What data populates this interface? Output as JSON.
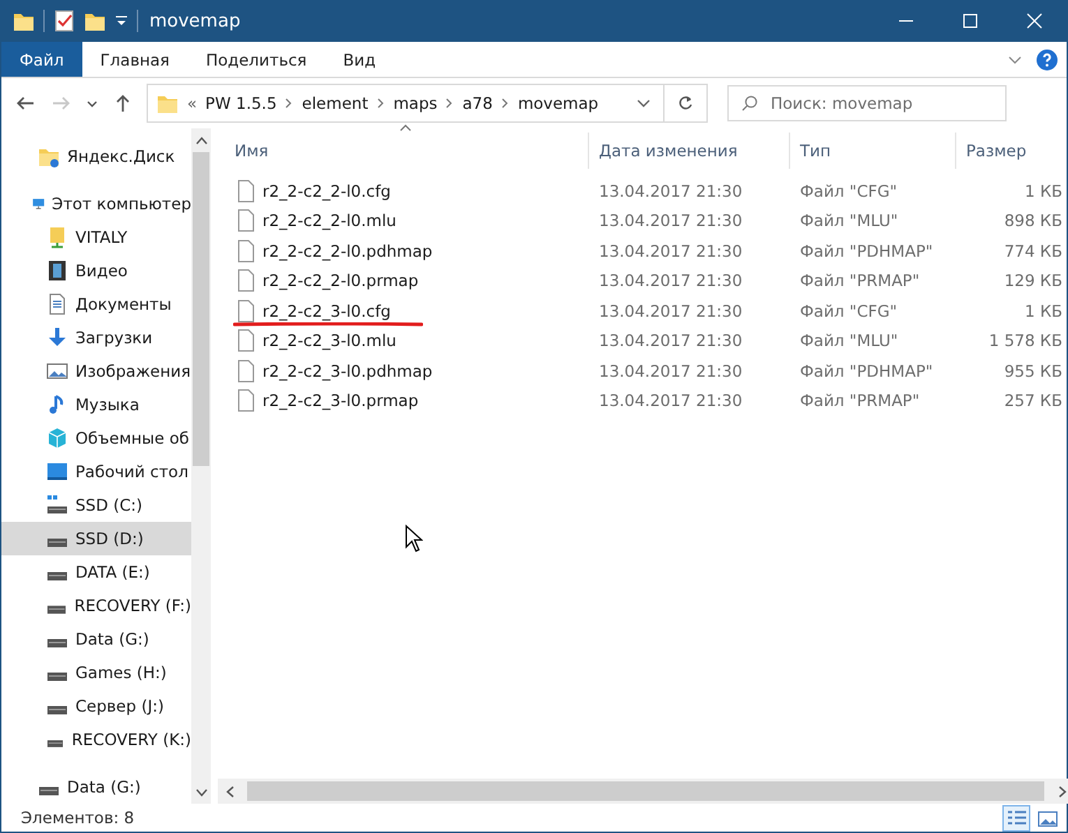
{
  "window": {
    "title": "movemap"
  },
  "ribbon_tabs": [
    {
      "label": "Файл",
      "selected": true
    },
    {
      "label": "Главная",
      "selected": false
    },
    {
      "label": "Поделиться",
      "selected": false
    },
    {
      "label": "Вид",
      "selected": false
    }
  ],
  "nav_buttons": [
    {
      "kind": "back",
      "disabled": false
    },
    {
      "kind": "forward",
      "disabled": true
    },
    {
      "kind": "recent",
      "disabled": false
    },
    {
      "kind": "up",
      "disabled": false
    }
  ],
  "address": {
    "overflow": "«",
    "crumbs": [
      "PW 1.5.5",
      "element",
      "maps",
      "a78",
      "movemap"
    ]
  },
  "search": {
    "placeholder": "Поиск: movemap"
  },
  "sidebar": {
    "items": [
      {
        "label": "Яндекс.Диск",
        "kind": "cloud",
        "selected": false
      },
      {
        "label": "Этот компьютер",
        "kind": "pc",
        "selected": false,
        "children": [
          {
            "label": "VITALY",
            "kind": "user",
            "selected": false
          },
          {
            "label": "Видео",
            "kind": "video",
            "selected": false
          },
          {
            "label": "Документы",
            "kind": "docs",
            "selected": false
          },
          {
            "label": "Загрузки",
            "kind": "downloads",
            "selected": false
          },
          {
            "label": "Изображения",
            "kind": "pictures",
            "selected": false
          },
          {
            "label": "Музыка",
            "kind": "music",
            "selected": false
          },
          {
            "label": "Объемные об",
            "kind": "objects",
            "selected": false
          },
          {
            "label": "Рабочий стол",
            "kind": "desktop",
            "selected": false
          },
          {
            "label": "SSD (C:)",
            "kind": "sysdrive",
            "selected": false
          },
          {
            "label": "SSD (D:)",
            "kind": "drive",
            "selected": true
          },
          {
            "label": "DATA (E:)",
            "kind": "drive",
            "selected": false
          },
          {
            "label": "RECOVERY (F:)",
            "kind": "drive",
            "selected": false
          },
          {
            "label": "Data (G:)",
            "kind": "drive",
            "selected": false
          },
          {
            "label": "Games (H:)",
            "kind": "drive",
            "selected": false
          },
          {
            "label": "Сервер (J:)",
            "kind": "drive",
            "selected": false
          },
          {
            "label": "RECOVERY (K:)",
            "kind": "drive",
            "selected": false
          }
        ]
      },
      {
        "label": "Data (G:)",
        "kind": "drive",
        "selected": false
      }
    ]
  },
  "table": {
    "columns": [
      {
        "label": "Имя",
        "sorted": true
      },
      {
        "label": "Дата изменения"
      },
      {
        "label": "Тип"
      },
      {
        "label": "Размер"
      }
    ],
    "rows": [
      {
        "name": "r2_2-c2_2-l0.cfg",
        "modified": "13.04.2017 21:30",
        "type": "Файл \"CFG\"",
        "size": "1 КБ"
      },
      {
        "name": "r2_2-c2_2-l0.mlu",
        "modified": "13.04.2017 21:30",
        "type": "Файл \"MLU\"",
        "size": "898 КБ"
      },
      {
        "name": "r2_2-c2_2-l0.pdhmap",
        "modified": "13.04.2017 21:30",
        "type": "Файл \"PDHMAP\"",
        "size": "774 КБ"
      },
      {
        "name": "r2_2-c2_2-l0.prmap",
        "modified": "13.04.2017 21:30",
        "type": "Файл \"PRMAP\"",
        "size": "129 КБ"
      },
      {
        "name": "r2_2-c2_3-l0.cfg",
        "modified": "13.04.2017 21:30",
        "type": "Файл \"CFG\"",
        "size": "1 КБ",
        "marked": true
      },
      {
        "name": "r2_2-c2_3-l0.mlu",
        "modified": "13.04.2017 21:30",
        "type": "Файл \"MLU\"",
        "size": "1 578 КБ"
      },
      {
        "name": "r2_2-c2_3-l0.pdhmap",
        "modified": "13.04.2017 21:30",
        "type": "Файл \"PDHMAP\"",
        "size": "955 КБ"
      },
      {
        "name": "r2_2-c2_3-l0.prmap",
        "modified": "13.04.2017 21:30",
        "type": "Файл \"PRMAP\"",
        "size": "257 КБ"
      }
    ]
  },
  "status_bar": {
    "count": "Элементов: 8",
    "views": [
      {
        "kind": "details",
        "selected": true
      },
      {
        "kind": "tiles",
        "selected": false
      }
    ]
  }
}
